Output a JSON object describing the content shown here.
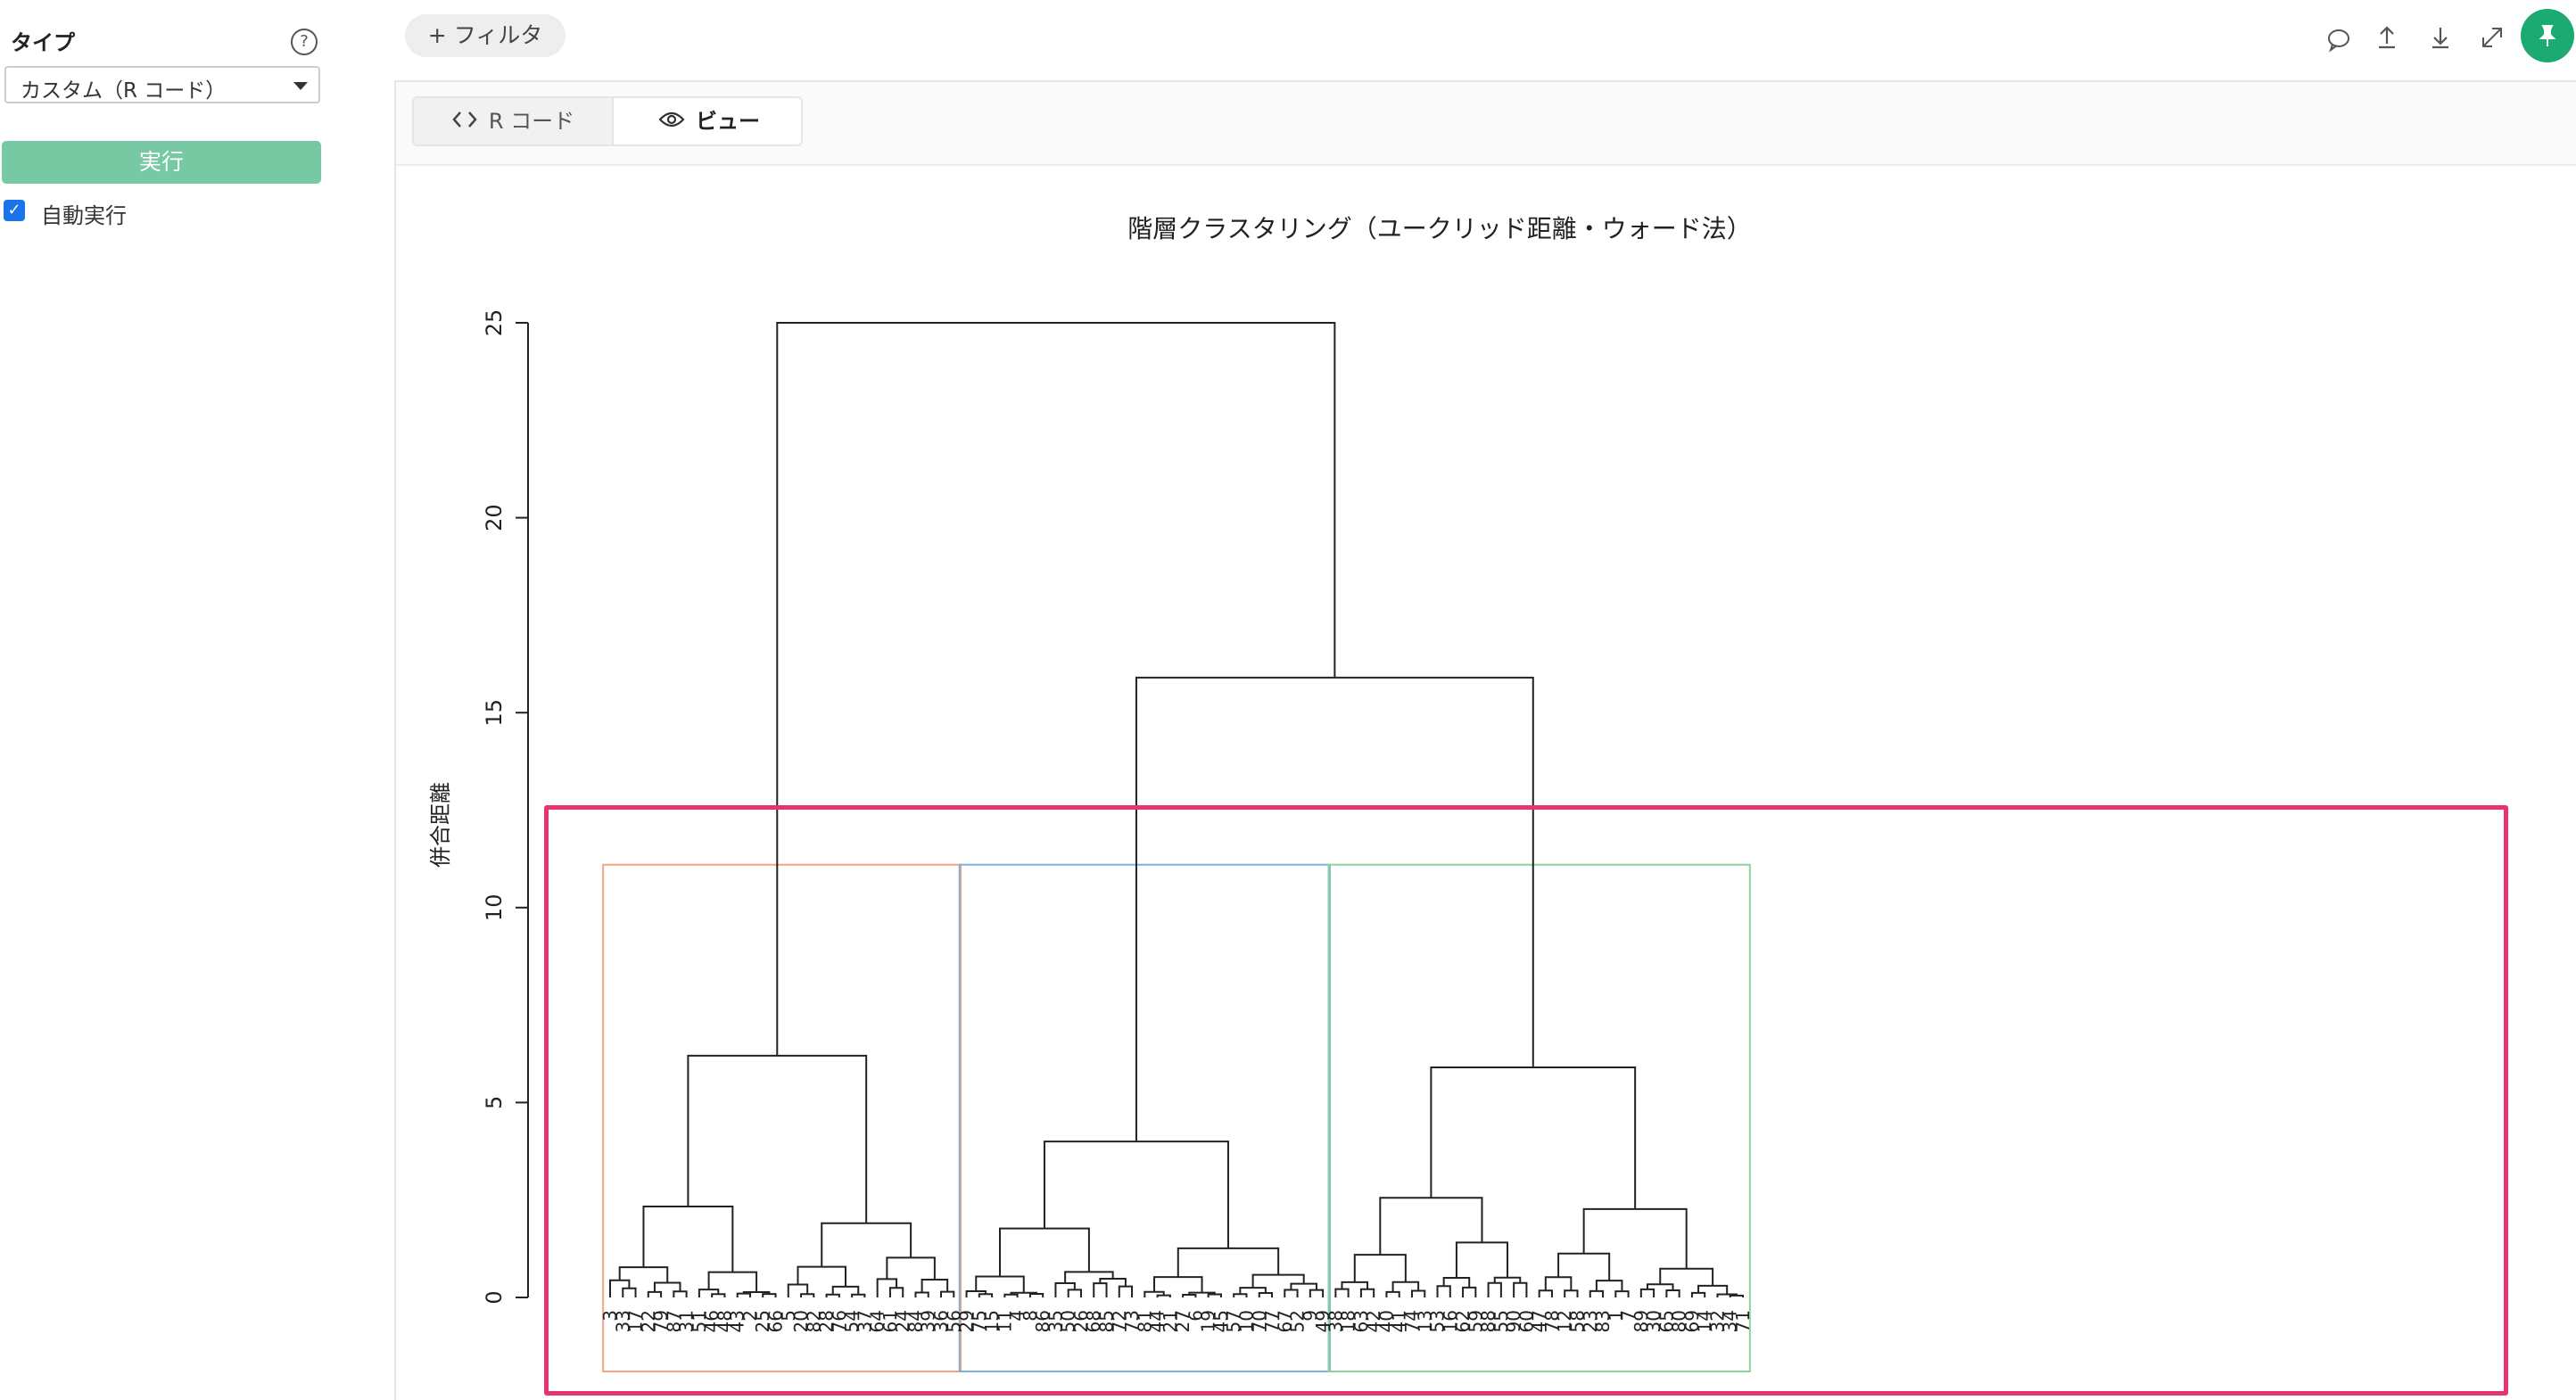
{
  "sidebar": {
    "type_label": "タイプ",
    "help_icon": "?",
    "type_select_value": "カスタム（R コード）",
    "run_label": "実行",
    "auto_run_label": "自動実行",
    "auto_run_checked": true
  },
  "toolbar": {
    "filter_label": "+ フィルタ",
    "icons": [
      "comment-icon",
      "upload-icon",
      "download-icon",
      "expand-icon",
      "pin-icon"
    ]
  },
  "tabs": [
    {
      "label": "R コード",
      "icon": "code-icon",
      "active": false
    },
    {
      "label": "ビュー",
      "icon": "eye-icon",
      "active": true
    }
  ],
  "colors": {
    "accent_green": "#1aaa72",
    "run_button": "#76c9a2",
    "highlight": "#e8336f",
    "cluster1": "#f4a582",
    "cluster2": "#7fb0d9",
    "cluster3": "#8fd19e"
  },
  "chart_data": {
    "type": "dendrogram",
    "title": "階層クラスタリング（ユークリッド距離・ウォード法）",
    "ylabel": "併合距離",
    "xlabel": "",
    "ylim": [
      0,
      25
    ],
    "yticks": [
      0,
      5,
      10,
      15,
      20,
      25
    ],
    "root_height": 25.0,
    "merge_heights": {
      "root": 25.0,
      "right_branch": 15.9,
      "cluster_1": 6.2,
      "cluster_2": 4.0,
      "cluster_3": 5.9
    },
    "clusters": [
      {
        "leaves": [
          "3",
          "33",
          "17",
          "22",
          "79",
          "87",
          "31",
          "51",
          "46",
          "48",
          "43",
          "2",
          "25",
          "66",
          "5",
          "20",
          "82",
          "28",
          "76",
          "54",
          "37",
          "64",
          "61",
          "24",
          "84",
          "39",
          "36",
          "56"
        ]
      },
      {
        "leaves": [
          "29",
          "75",
          "15",
          "11",
          "4",
          "8",
          "86",
          "35",
          "50",
          "26",
          "68",
          "85",
          "72",
          "73",
          "81",
          "44",
          "21",
          "27",
          "6",
          "19",
          "45",
          "57",
          "10",
          "70",
          "77",
          "67",
          "52",
          "9",
          "49"
        ]
      },
      {
        "leaves": [
          "38",
          "18",
          "63",
          "42",
          "40",
          "41",
          "74",
          "13",
          "53",
          "16",
          "62",
          "59",
          "88",
          "55",
          "90",
          "60",
          "47",
          "78",
          "12",
          "58",
          "23",
          "83",
          "1",
          "7",
          "89",
          "30",
          "65",
          "80",
          "69",
          "14",
          "32",
          "34",
          "71"
        ]
      }
    ]
  }
}
